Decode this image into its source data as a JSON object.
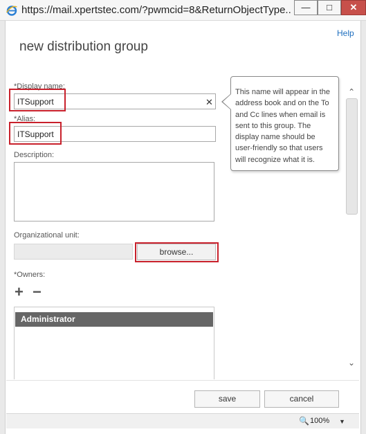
{
  "browser": {
    "url": "https://mail.xpertstec.com/?pwmcid=8&ReturnObjectType...",
    "minimize_glyph": "—",
    "maximize_glyph": "□",
    "close_glyph": "✕"
  },
  "dialog": {
    "help_label": "Help",
    "title": "new distribution group"
  },
  "form": {
    "display_name": {
      "label": "*Display name:",
      "value": "ITSupport",
      "clear_glyph": "✕"
    },
    "alias": {
      "label": "*Alias:",
      "value": "ITSupport"
    },
    "description": {
      "label": "Description:",
      "value": ""
    },
    "organizational_unit": {
      "label": "Organizational unit:",
      "value": "",
      "browse_label": "browse..."
    },
    "owners": {
      "label": "*Owners:",
      "add_glyph": "+",
      "remove_glyph": "−",
      "items": [
        "Administrator"
      ]
    }
  },
  "tooltip": {
    "text": "This name will appear in the address book and on the To and Cc lines when email is sent to this group. The display name should be user-friendly so that users will recognize what it is."
  },
  "scrollbar": {
    "up_glyph": "⌄",
    "down_glyph": "⌄"
  },
  "footer": {
    "save_label": "save",
    "cancel_label": "cancel"
  },
  "statusbar": {
    "zoom_icon": "zoom-icon",
    "zoom_glyph": "🔍",
    "zoom_level": "100%",
    "zoom_caret": "▼"
  },
  "colors": {
    "highlight_red": "#c8202b",
    "link_blue": "#1e6fbf",
    "selected_row": "#666666"
  }
}
